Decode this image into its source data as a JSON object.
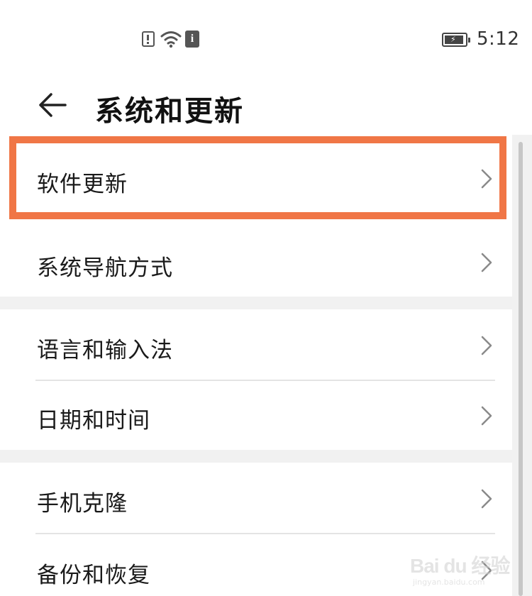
{
  "status_bar": {
    "time": "5:12",
    "icons": [
      "alert-icon",
      "wifi-icon",
      "info-icon",
      "battery-icon"
    ]
  },
  "header": {
    "back_icon": "arrow-left-icon",
    "title": "系统和更新"
  },
  "groups": [
    {
      "items": [
        {
          "label": "软件更新",
          "highlighted": true
        },
        {
          "label": "系统导航方式"
        }
      ]
    },
    {
      "items": [
        {
          "label": "语言和输入法"
        },
        {
          "label": "日期和时间"
        }
      ]
    },
    {
      "items": [
        {
          "label": "手机克隆"
        },
        {
          "label": "备份和恢复"
        }
      ]
    }
  ],
  "highlight_color": "#f07646",
  "watermark": {
    "logo": "Bai du 经验",
    "url": "jingyan.baidu.com"
  }
}
